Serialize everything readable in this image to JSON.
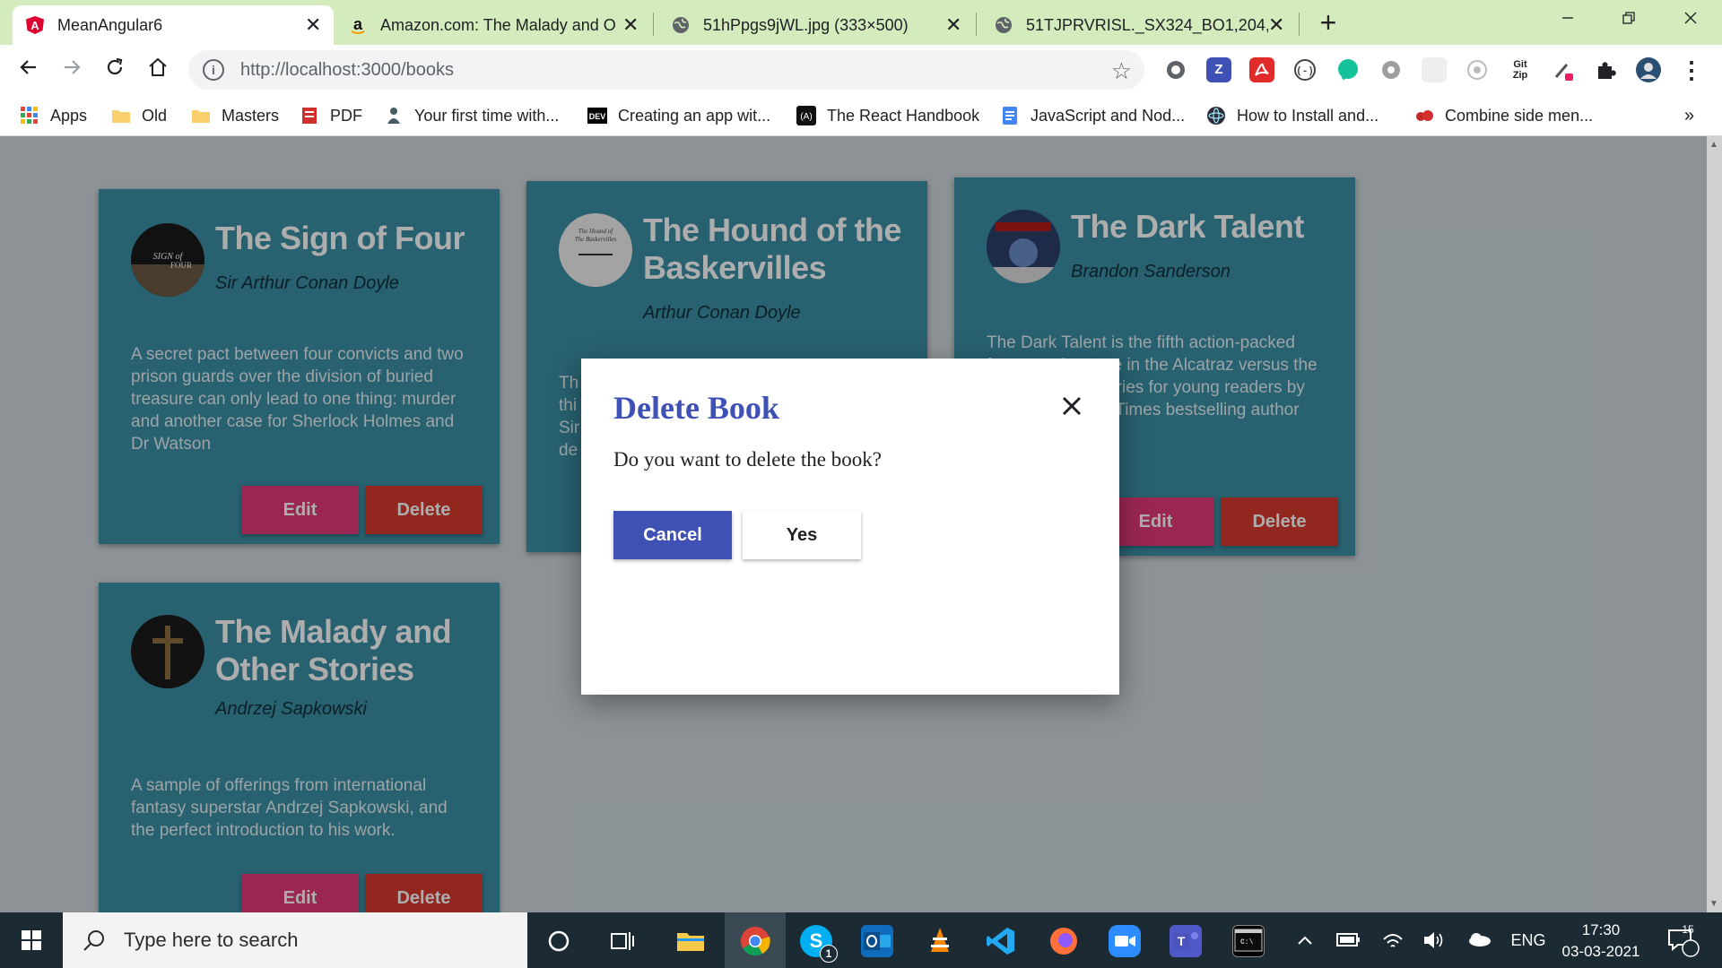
{
  "browser": {
    "tabs": [
      {
        "title": "MeanAngular6",
        "close": "✕"
      },
      {
        "title": "Amazon.com: The Malady and O",
        "close": "✕"
      },
      {
        "title": "51hPpgs9jWL.jpg (333×500)",
        "close": "✕"
      },
      {
        "title": "51TJPRVRISL._SX324_BO1,204,20",
        "close": "✕"
      }
    ],
    "new_tab": "+",
    "url": "http://localhost:3000/books",
    "extensions": [
      "Z",
      "Git Zip"
    ],
    "bookmarks": [
      {
        "label": "Apps"
      },
      {
        "label": "Old"
      },
      {
        "label": "Masters"
      },
      {
        "label": "PDF"
      },
      {
        "label": "Your first time with..."
      },
      {
        "label": "Creating an app wit..."
      },
      {
        "label": "The React Handbook"
      },
      {
        "label": "JavaScript and Nod..."
      },
      {
        "label": "How to Install and..."
      },
      {
        "label": "Combine side men..."
      }
    ],
    "bookmarks_overflow": "»"
  },
  "books": [
    {
      "title": "The Sign of Four",
      "author": "Sir Arthur Conan Doyle",
      "description": "A secret pact between four convicts and two prison guards over the division of buried treasure can only lead to one thing: murder and another case for Sherlock Holmes and Dr Watson",
      "edit_label": "Edit",
      "delete_label": "Delete"
    },
    {
      "title": "The Hound of the Baskervilles",
      "author": "Arthur Conan Doyle",
      "description": "Th thi Sir de",
      "edit_label": "Edit",
      "delete_label": "Delete"
    },
    {
      "title": "The Dark Talent",
      "author": "Brandon Sanderson",
      "description": "The Dark Talent is the fifth action-packed fantasy adventure in the Alcatraz versus the Evil Librarians series for young readers by the #1 New York Times bestselling author Brandon",
      "edit_label": "Edit",
      "delete_label": "Delete"
    },
    {
      "title": "The Malady and Other Stories",
      "author": "Andrzej Sapkowski",
      "description": "A sample of offerings from international fantasy superstar Andrzej Sapkowski, and the perfect introduction to his work.",
      "edit_label": "Edit",
      "delete_label": "Delete"
    }
  ],
  "dialog": {
    "title": "Delete Book",
    "message": "Do you want to delete the book?",
    "cancel_label": "Cancel",
    "confirm_label": "Yes"
  },
  "taskbar": {
    "search_placeholder": "Type here to search",
    "skype_badge": "1",
    "language": "ENG",
    "time": "17:30",
    "date": "03-03-2021",
    "notifications": "15"
  },
  "colors": {
    "card": "#3b8fa6",
    "edit_button": "#e3387a",
    "delete_button": "#d83a2e",
    "dialog_accent": "#3f51b5",
    "tabstrip": "#d3ebbd"
  }
}
